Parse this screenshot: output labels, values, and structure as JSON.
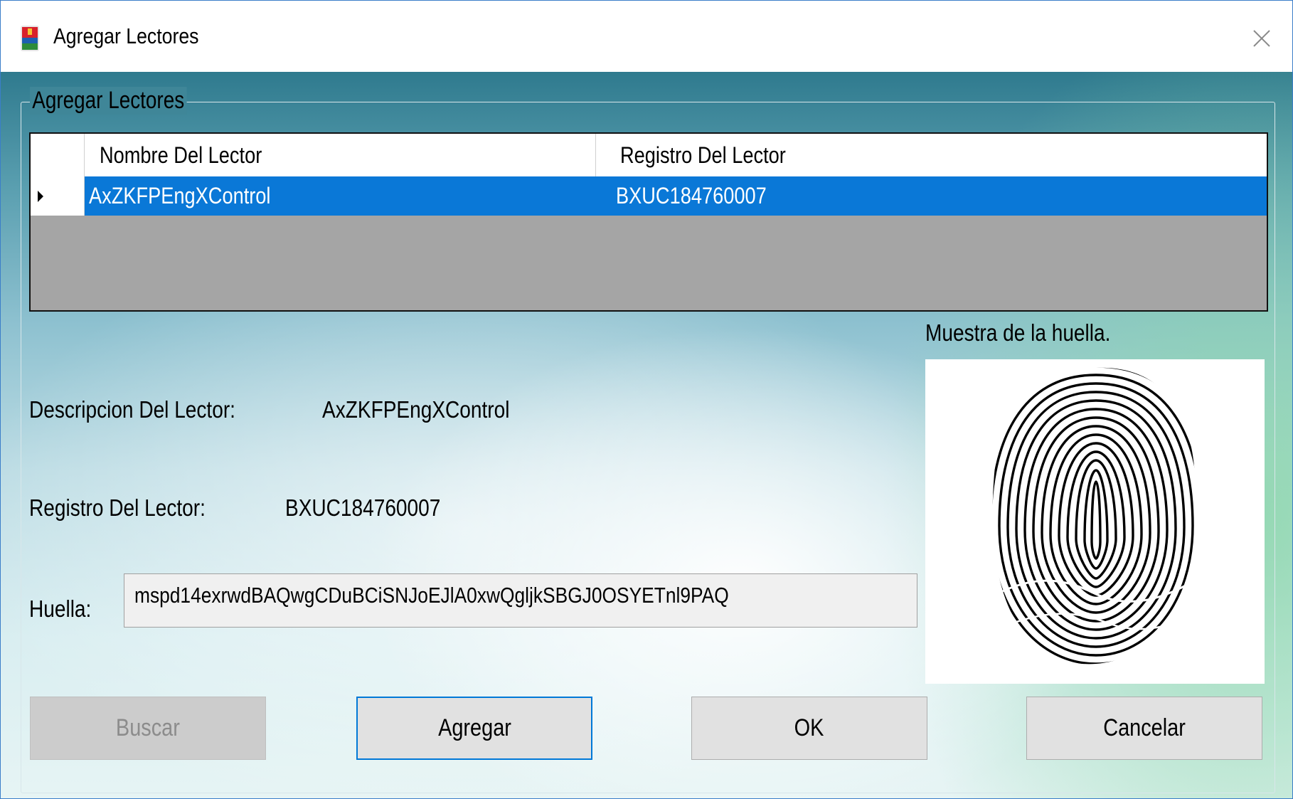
{
  "window": {
    "title": "Agregar Lectores",
    "close_icon": "close-icon",
    "app_icon": "app-shield-icon"
  },
  "group": {
    "legend": "Agregar Lectores"
  },
  "readers_table": {
    "columns": [
      "Nombre Del Lector",
      "Registro Del Lector"
    ],
    "rows": [
      {
        "nombre": "AxZKFPEngXControl",
        "registro": "BXUC184760007",
        "selected": true
      }
    ],
    "selection_color": "#0a78d7"
  },
  "details": {
    "descripcion_label": "Descripcion Del Lector:",
    "descripcion_value": "AxZKFPEngXControl",
    "registro_label": "Registro Del Lector:",
    "registro_value": "BXUC184760007",
    "huella_label": "Huella:",
    "huella_value": "mspd14exrwdBAQwgCDuBCiSNJoEJlA0xwQgljkSBGJ0OSYETnl9PAQ"
  },
  "fingerprint": {
    "caption": "Muestra de la huella.",
    "icon": "fingerprint-image"
  },
  "buttons": {
    "buscar": "Buscar",
    "agregar": "Agregar",
    "ok": "OK",
    "cancelar": "Cancelar"
  }
}
